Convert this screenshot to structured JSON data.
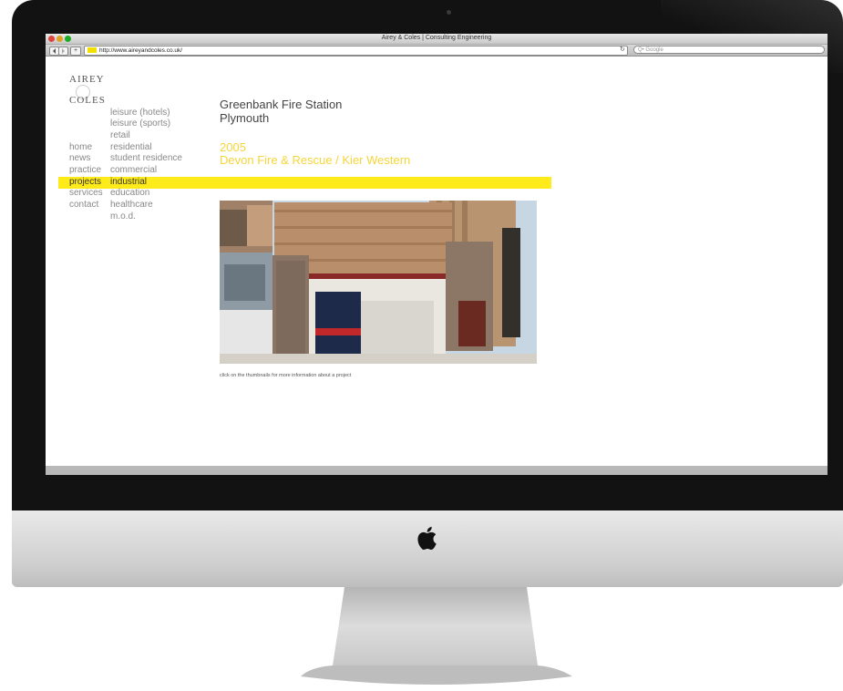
{
  "window": {
    "title": "Airey & Coles | Consulting Engineering"
  },
  "toolbar": {
    "back_icon": "chevron-left-icon",
    "forward_icon": "chevron-right-icon",
    "add_label": "+",
    "url": "http://www.aireyandcoles.co.uk/",
    "reload_icon": "reload-icon",
    "search_placeholder": "Q• Google"
  },
  "logo": {
    "line1": "AIREY",
    "line2": "COLES"
  },
  "nav": {
    "main": [
      "home",
      "news",
      "practice",
      "projects",
      "services",
      "contact"
    ],
    "active": "projects",
    "sub": [
      "leisure (hotels)",
      "leisure (sports)",
      "retail",
      "residential",
      "student residence",
      "commercial",
      "industrial",
      "education",
      "healthcare",
      "m.o.d."
    ],
    "sub_active": "industrial"
  },
  "project": {
    "title_line1": "Greenbank Fire Station",
    "title_line2": "Plymouth",
    "year": "2005",
    "client": "Devon Fire & Rescue / Kier Western",
    "caption": "click on the thumbnails for more information about a project"
  },
  "colors": {
    "highlight": "#ffeb1a",
    "accent_text": "#f6d53a"
  }
}
